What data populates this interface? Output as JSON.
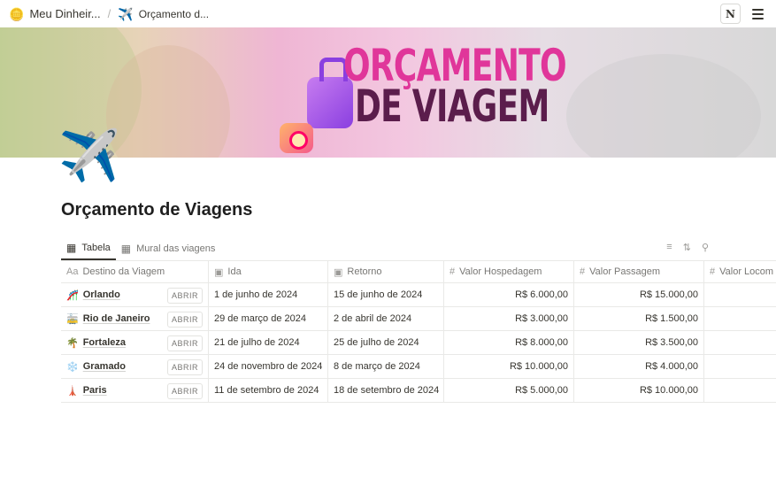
{
  "breadcrumb": {
    "item1": {
      "icon": "🪙",
      "label": "Meu Dinheir..."
    },
    "separator": "/",
    "item2": {
      "icon": "✈️",
      "label": "Orçamento d..."
    }
  },
  "topbar": {
    "notion_icon": "N"
  },
  "cover": {
    "line1": "ORÇAMENTO",
    "line2": "DE VIAGEM"
  },
  "page": {
    "icon": "✈️",
    "title": "Orçamento de Viagens"
  },
  "views": {
    "tabs": [
      {
        "icon": "table-icon",
        "label": "Tabela"
      },
      {
        "icon": "gallery-icon",
        "label": "Mural das viagens"
      }
    ]
  },
  "table": {
    "columns": [
      "Destino da Viagem",
      "Ida",
      "Retorno",
      "Valor Hospedagem",
      "Valor Passagem",
      "Valor Locom"
    ],
    "open_label": "ABRIR",
    "rows": [
      {
        "emoji": "🎢",
        "destino": "Orlando",
        "ida": "1 de junho de 2024",
        "retorno": "15 de junho de 2024",
        "hospedagem": "R$ 6.000,00",
        "passagem": "R$ 15.000,00",
        "locomocao": ""
      },
      {
        "emoji": "🚋",
        "destino": "Rio de Janeiro",
        "ida": "29 de março de 2024",
        "retorno": "2 de abril de 2024",
        "hospedagem": "R$ 3.000,00",
        "passagem": "R$ 1.500,00",
        "locomocao": ""
      },
      {
        "emoji": "🌴",
        "destino": "Fortaleza",
        "ida": "21 de julho de 2024",
        "retorno": "25 de julho de 2024",
        "hospedagem": "R$ 8.000,00",
        "passagem": "R$ 3.500,00",
        "locomocao": ""
      },
      {
        "emoji": "❄️",
        "destino": "Gramado",
        "ida": "24 de novembro de 2024",
        "retorno": "8 de março de 2024",
        "hospedagem": "R$ 10.000,00",
        "passagem": "R$ 4.000,00",
        "locomocao": ""
      },
      {
        "emoji": "🗼",
        "destino": "Paris",
        "ida": "11 de setembro de 2024",
        "retorno": "18 de setembro de 2024",
        "hospedagem": "R$ 5.000,00",
        "passagem": "R$ 10.000,00",
        "locomocao": ""
      }
    ]
  }
}
